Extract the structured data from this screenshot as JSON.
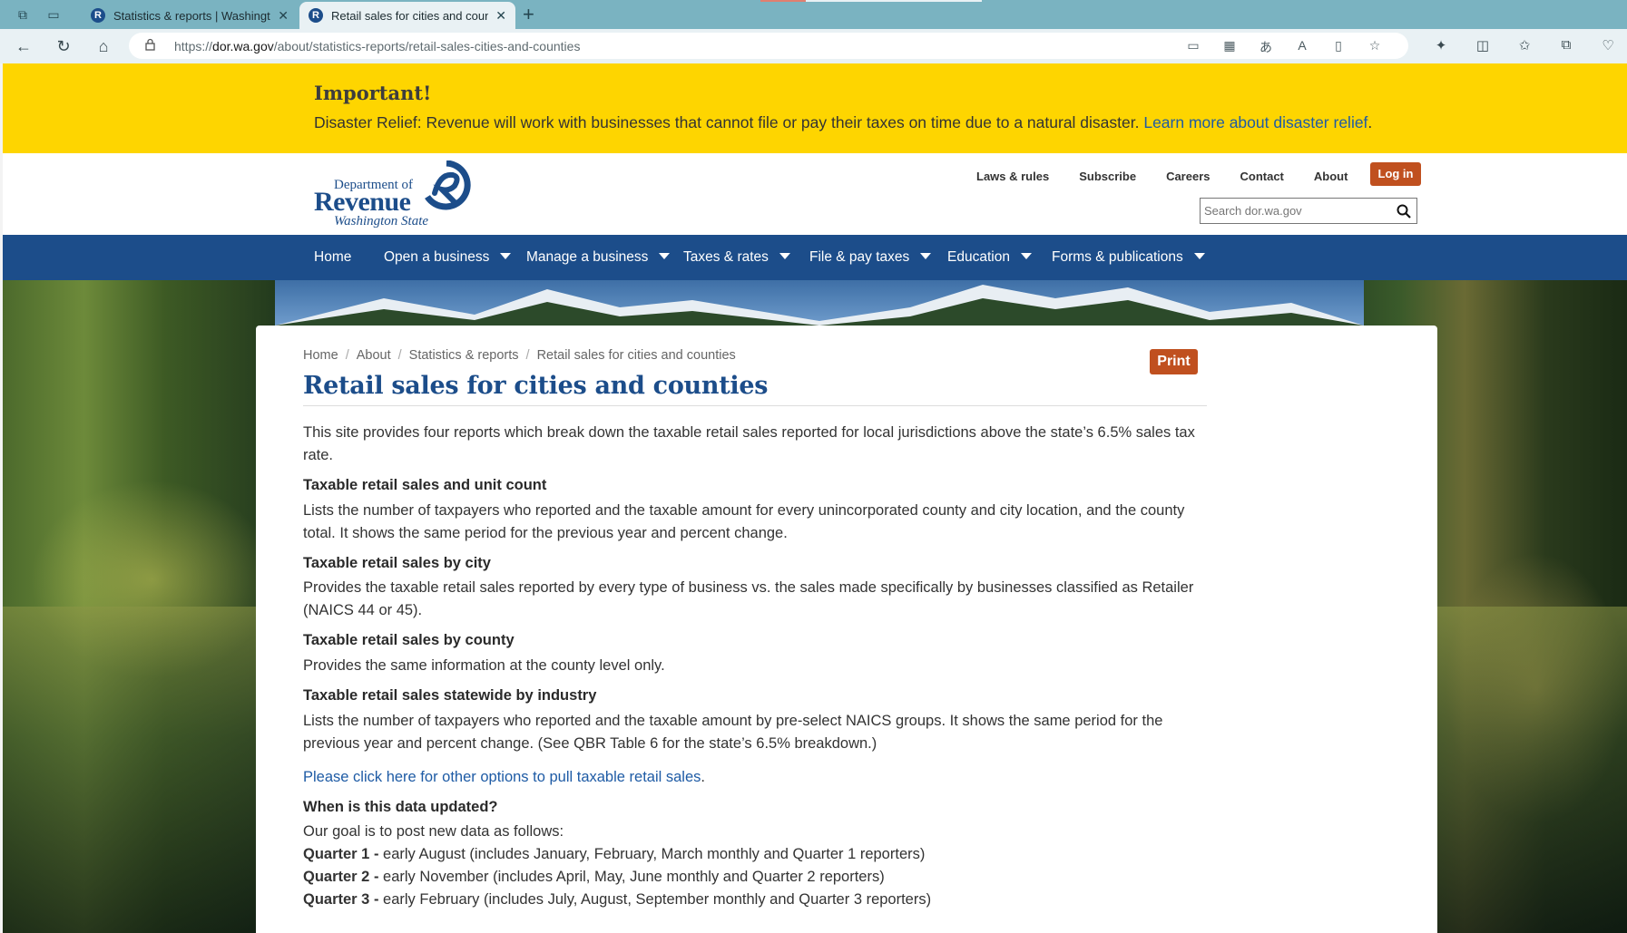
{
  "browser": {
    "tabs": [
      {
        "title": "Statistics & reports | Washington",
        "active": false
      },
      {
        "title": "Retail sales for cities and countie",
        "active": true
      }
    ],
    "url_prefix": "https://",
    "url_domain": "dor.wa.gov",
    "url_path": "/about/statistics-reports/retail-sales-cities-and-counties"
  },
  "alert": {
    "title": "Important!",
    "text": "Disaster Relief: Revenue will work with businesses that cannot file or pay their taxes on time due to a natural disaster. ",
    "link": "Learn more about disaster relief",
    "trailing": "."
  },
  "header": {
    "logo": {
      "line1": "Department of",
      "line2": "Revenue",
      "line3": "Washington State"
    },
    "utility_links": [
      "Laws & rules",
      "Subscribe",
      "Careers",
      "Contact",
      "About"
    ],
    "login_label": "Log in",
    "search_placeholder": "Search dor.wa.gov"
  },
  "nav": [
    "Home",
    "Open a business",
    "Manage a business",
    "Taxes & rates",
    "File & pay taxes",
    "Education",
    "Forms & publications"
  ],
  "content": {
    "breadcrumb": [
      "Home",
      "About",
      "Statistics & reports",
      "Retail sales for cities and counties"
    ],
    "print_label": "Print",
    "title": "Retail sales for cities and counties",
    "intro": "This site provides four reports which break down the taxable retail sales reported for local jurisdictions above the state’s 6.5% sales tax rate.",
    "sections": [
      {
        "heading": "Taxable retail sales and unit count",
        "text": "Lists the number of taxpayers who reported and the taxable amount for every unincorporated county and city location, and the county total. It shows the same period for the previous year and percent change."
      },
      {
        "heading": "Taxable retail sales by city",
        "text": "Provides the taxable retail sales reported by every type of business vs. the sales made specifically by businesses classified as Retailer (NAICS 44 or 45)."
      },
      {
        "heading": "Taxable retail sales by county",
        "text": "Provides the same information at the county level only."
      },
      {
        "heading": "Taxable retail sales statewide by industry",
        "text": "Lists the number of taxpayers who reported and the taxable amount by pre-select NAICS groups. It shows the same period for the previous year and percent change. (See QBR Table 6 for the state’s 6.5% breakdown.)"
      }
    ],
    "other_options_link": "Please click here for other options to pull taxable retail sales",
    "other_options_trailing": ".",
    "updated_heading": "When is this data updated?",
    "updated_intro": "Our goal is to post new data as follows:",
    "quarters": [
      {
        "label": "Quarter 1 -",
        "text": " early August (includes January, February, March monthly and Quarter 1 reporters)"
      },
      {
        "label": "Quarter 2 -",
        "text": " early November (includes April, May, June monthly and Quarter 2 reporters)"
      },
      {
        "label": "Quarter 3 -",
        "text": " early February (includes July, August, September monthly and Quarter 3 reporters)"
      }
    ]
  }
}
